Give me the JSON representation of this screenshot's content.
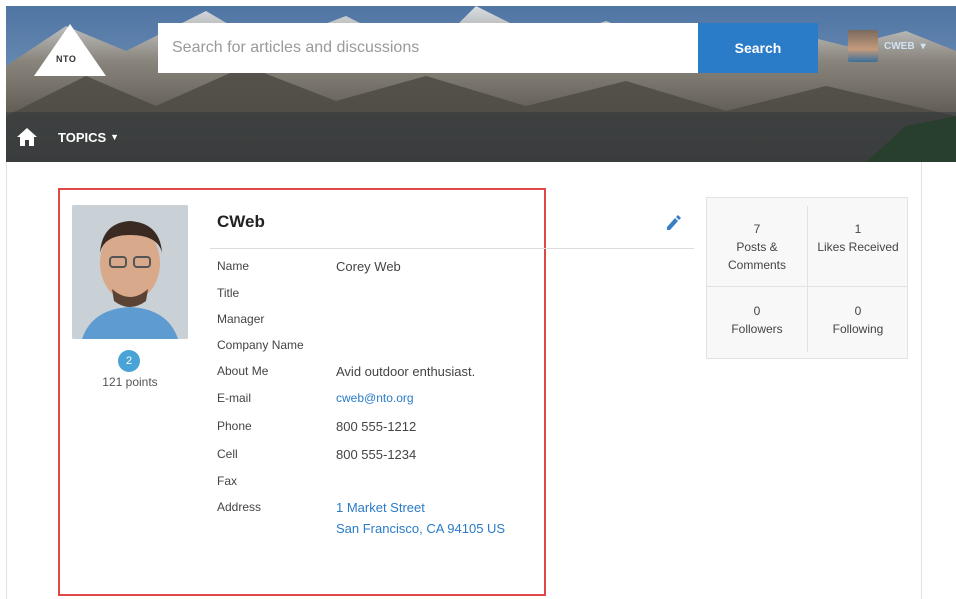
{
  "header": {
    "logo_text": "NTO",
    "search_placeholder": "Search for articles and discussions",
    "search_button": "Search",
    "user_name": "CWEB",
    "nav_topics": "TOPICS"
  },
  "profile": {
    "name": "CWeb",
    "points_level": "2",
    "points_text": "121 points",
    "fields": [
      {
        "label": "Name",
        "value": "Corey Web"
      },
      {
        "label": "Title",
        "value": ""
      },
      {
        "label": "Manager",
        "value": ""
      },
      {
        "label": "Company Name",
        "value": ""
      },
      {
        "label": "About Me",
        "value": "Avid outdoor enthusiast."
      },
      {
        "label": "E-mail",
        "value": "cweb@nto.org"
      },
      {
        "label": "Phone",
        "value": "800 555-1212"
      },
      {
        "label": "Cell",
        "value": "800 555-1234"
      },
      {
        "label": "Fax",
        "value": ""
      },
      {
        "label": "Address",
        "value": "1 Market Street",
        "value2": "San Francisco, CA 94105 US"
      }
    ]
  },
  "stats": [
    {
      "count": "7",
      "label": "Posts &",
      "label2": "Comments"
    },
    {
      "count": "1",
      "label": "Likes Received"
    },
    {
      "count": "0",
      "label": "Followers"
    },
    {
      "count": "0",
      "label": "Following"
    }
  ],
  "colors": {
    "accent": "#2a7bc8",
    "highlight_border": "#e04848",
    "badge": "#4aa3d6"
  }
}
